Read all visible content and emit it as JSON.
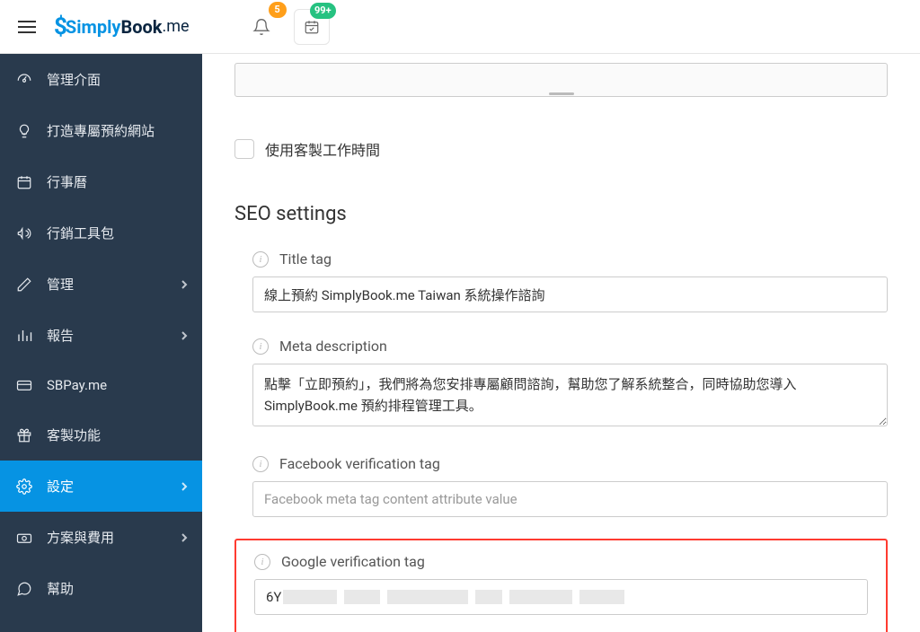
{
  "topbar": {
    "badge_notifications": "5",
    "badge_tasks": "99+"
  },
  "logo": {
    "part1": "Simply",
    "part2": "Book",
    "part3": ".me"
  },
  "sidebar": {
    "items": [
      {
        "label": "管理介面",
        "icon": "dashboard",
        "has_chevron": false
      },
      {
        "label": "打造專屬預約網站",
        "icon": "bulb",
        "has_chevron": false
      },
      {
        "label": "行事曆",
        "icon": "calendar",
        "has_chevron": false
      },
      {
        "label": "行銷工具包",
        "icon": "megaphone",
        "has_chevron": false
      },
      {
        "label": "管理",
        "icon": "pencil",
        "has_chevron": true
      },
      {
        "label": "報告",
        "icon": "barchart",
        "has_chevron": true
      },
      {
        "label": "SBPay.me",
        "icon": "card",
        "has_chevron": false
      },
      {
        "label": "客製功能",
        "icon": "gift",
        "has_chevron": false
      },
      {
        "label": "設定",
        "icon": "gear",
        "has_chevron": true,
        "active": true
      },
      {
        "label": "方案與費用",
        "icon": "money",
        "has_chevron": true
      },
      {
        "label": "幫助",
        "icon": "chat",
        "has_chevron": false
      }
    ]
  },
  "content": {
    "checkbox_label": "使用客製工作時間",
    "section_title": "SEO settings",
    "title_tag_label": "Title tag",
    "title_tag_value": "線上預約 SimplyBook.me Taiwan 系統操作諮詢",
    "meta_desc_label": "Meta description",
    "meta_desc_value": "點擊「立即預約」，我們將為您安排專屬顧問諮詢，幫助您了解系統整合，同時協助您導入 SimplyBook.me 預約排程管理工具。",
    "fb_tag_label": "Facebook verification tag",
    "fb_tag_placeholder": "Facebook meta tag content attribute value",
    "google_tag_label": "Google verification tag",
    "google_tag_value": "6Y"
  }
}
